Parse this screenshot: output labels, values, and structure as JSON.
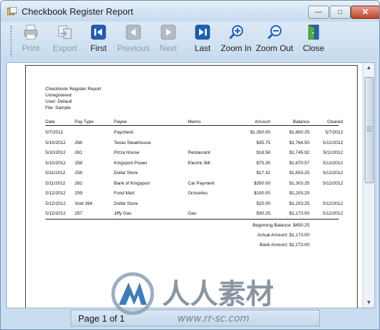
{
  "window": {
    "title": "Checkbook Register Report"
  },
  "toolbar": {
    "print": "Print",
    "export": "Export",
    "first": "First",
    "previous": "Previous",
    "next": "Next",
    "last": "Last",
    "zoom_in": "Zoom In",
    "zoom_out": "Zoom Out",
    "close": "Close"
  },
  "report": {
    "heading": [
      "Checkbook Register Report",
      "Unregistered",
      "User: Default",
      "File: Sample"
    ],
    "columns": {
      "date": "Date",
      "pay_type": "Pay Type",
      "payee": "Payee",
      "memo": "Memo",
      "amount": "Amount",
      "balance": "Balance",
      "cleared": "Cleared"
    },
    "rows": [
      {
        "date": "5/7/2012",
        "pay_type": "",
        "payee": "Paycheck",
        "memo": "",
        "amount": "$1,350.00",
        "balance": "$1,800.25",
        "cleared": "5/7/2012"
      },
      {
        "date": "5/10/2012",
        "pay_type": "266",
        "payee": "Texas Steakhouse",
        "memo": "",
        "amount": "$35.75",
        "balance": "$1,764.50",
        "cleared": "5/12/2012"
      },
      {
        "date": "5/10/2012",
        "pay_type": "261",
        "payee": "Pizza House",
        "memo": "Restaurant",
        "amount": "$18.58",
        "balance": "$1,745.92",
        "cleared": "5/11/2012"
      },
      {
        "date": "5/10/2012",
        "pay_type": "258",
        "payee": "Kingsport Power",
        "memo": "Electric Bill",
        "amount": "$75.35",
        "balance": "$1,670.57",
        "cleared": "5/12/2012"
      },
      {
        "date": "5/11/2012",
        "pay_type": "256",
        "payee": "Dollar Store",
        "memo": "",
        "amount": "$17.32",
        "balance": "$1,653.25",
        "cleared": "5/12/2012"
      },
      {
        "date": "5/11/2012",
        "pay_type": "262",
        "payee": "Bank of Kingsport",
        "memo": "Car Payment",
        "amount": "$350.00",
        "balance": "$1,303.25",
        "cleared": "5/12/2012"
      },
      {
        "date": "5/12/2012",
        "pay_type": "259",
        "payee": "Food Mart",
        "memo": "Groceries",
        "amount": "$100.00",
        "balance": "$1,203.25",
        "cleared": ""
      },
      {
        "date": "5/12/2012",
        "pay_type": "Void 264",
        "payee": "Dollar Store",
        "memo": "",
        "amount": "$25.00",
        "balance": "$1,203.25",
        "cleared": "5/12/2012"
      },
      {
        "date": "5/12/2012",
        "pay_type": "257",
        "payee": "Jiffy Gas",
        "memo": "Gas",
        "amount": "$30.25",
        "balance": "$1,173.00",
        "cleared": "5/12/2012"
      }
    ],
    "totals": [
      "Beginning Balance: $450.25",
      "Actual Amount: $1,173.00",
      "Bank Amount: $1,273.00"
    ]
  },
  "status": {
    "page": "Page 1 of 1"
  },
  "watermark": {
    "cjk": "人人素材",
    "url": "www.rr-sc.com"
  },
  "colors": {
    "toolbar_blue": "#1f5fb0",
    "window_frame": "#c9ddf1"
  }
}
